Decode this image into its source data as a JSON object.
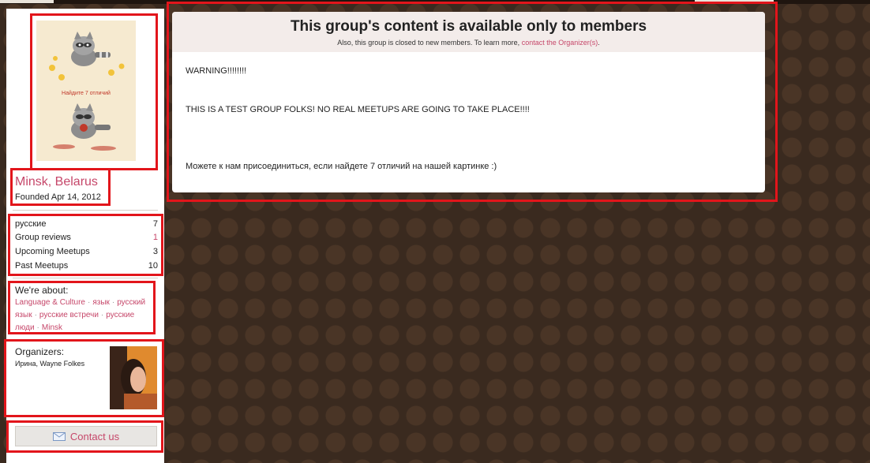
{
  "group": {
    "city": "Minsk, Belarus",
    "founded": "Founded Apr 14, 2012"
  },
  "stats": [
    {
      "label": "русские",
      "count": "7"
    },
    {
      "label": "Group reviews",
      "count": "1"
    },
    {
      "label": "Upcoming Meetups",
      "count": "3"
    },
    {
      "label": "Past Meetups",
      "count": "10"
    }
  ],
  "about": {
    "title": "We're about:",
    "tags": [
      "Language & Culture",
      "язык",
      "русский язык",
      "русские встречи",
      "русские люди",
      "Minsk"
    ]
  },
  "organizers": {
    "title": "Organizers:",
    "names": "Ирина, Wayne Folkes"
  },
  "contact": {
    "label": "Contact us",
    "icon": "envelope-icon"
  },
  "logo": {
    "text": "Найдите 7 отличий",
    "icon": "raccoon-illustration"
  },
  "content": {
    "title": "This group's content is available only to members",
    "note_prefix": "Also, this group is closed to new members. To learn more, ",
    "note_link": "contact the Organizer(s)",
    "note_suffix": ".",
    "lines": [
      "WARNING!!!!!!!!",
      "THIS IS A TEST GROUP FOLKS! NO REAL MEETUPS ARE GOING TO TAKE PLACE!!!!",
      "Можете к нам присоединиться, если найдете 7 отличий на нашей картинке :)"
    ]
  },
  "colors": {
    "accent": "#c6476a",
    "highlight": "#e2151b",
    "background": "#3a2a1f"
  }
}
